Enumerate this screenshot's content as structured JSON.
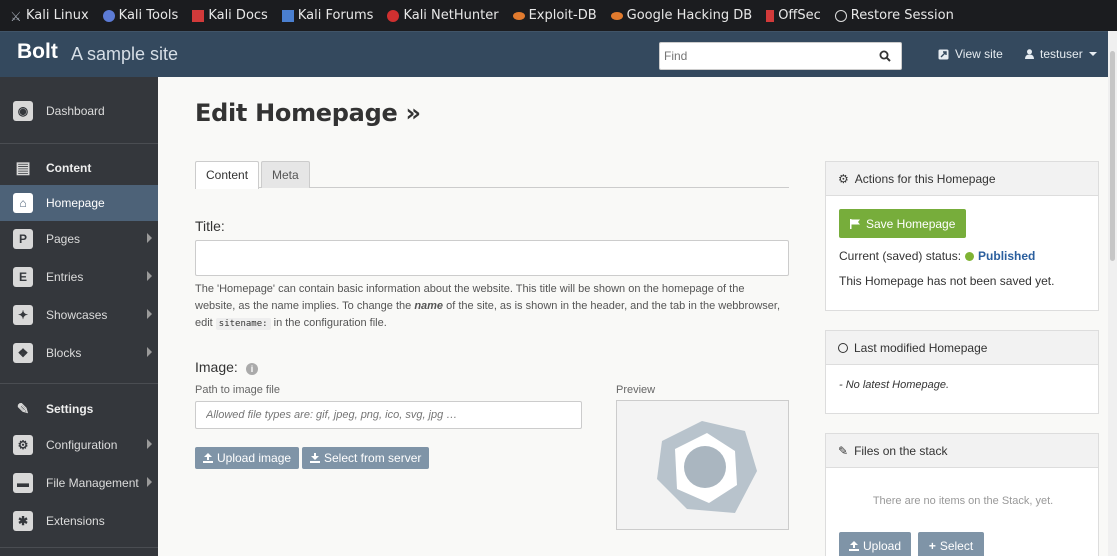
{
  "bookmarks": [
    {
      "label": "Kali Linux",
      "icon": "kali-dragon-icon",
      "color": "#a0a6b0"
    },
    {
      "label": "Kali Tools",
      "icon": "kali-tools-icon",
      "color": "#5c7bd6"
    },
    {
      "label": "Kali Docs",
      "icon": "kali-docs-icon",
      "color": "#d23a3a"
    },
    {
      "label": "Kali Forums",
      "icon": "kali-forums-icon",
      "color": "#4a7fd0"
    },
    {
      "label": "Kali NetHunter",
      "icon": "nethunter-icon",
      "color": "#cf3030"
    },
    {
      "label": "Exploit-DB",
      "icon": "exploit-db-icon",
      "color": "#e07a2e"
    },
    {
      "label": "Google Hacking DB",
      "icon": "ghdb-icon",
      "color": "#e07a2e"
    },
    {
      "label": "OffSec",
      "icon": "offsec-icon",
      "color": "#d23a3a"
    },
    {
      "label": "Restore Session",
      "icon": "globe-icon",
      "color": "#dddddd"
    }
  ],
  "topbar": {
    "brand": "Bolt",
    "site_name": "A sample site",
    "search_placeholder": "Find",
    "view_site": "View site",
    "user": "testuser"
  },
  "sidebar": {
    "items": [
      {
        "label": "Dashboard",
        "icon": "dashboard-icon",
        "glyph": "◉"
      },
      {
        "label": "Content",
        "icon": "content-file-icon",
        "glyph": "▤"
      },
      {
        "label": "Homepage",
        "icon": "home-icon",
        "glyph": "⌂"
      },
      {
        "label": "Pages",
        "icon": "pages-icon",
        "glyph": "P"
      },
      {
        "label": "Entries",
        "icon": "entries-icon",
        "glyph": "E"
      },
      {
        "label": "Showcases",
        "icon": "gift-icon",
        "glyph": "✦"
      },
      {
        "label": "Blocks",
        "icon": "blocks-icon",
        "glyph": "❖"
      },
      {
        "label": "Settings",
        "icon": "wrench-icon",
        "glyph": "🔧"
      },
      {
        "label": "Configuration",
        "icon": "cogs-icon",
        "glyph": "⚙"
      },
      {
        "label": "File Management",
        "icon": "folder-icon",
        "glyph": "▬"
      },
      {
        "label": "Extensions",
        "icon": "extensions-icon",
        "glyph": "✱"
      }
    ]
  },
  "main": {
    "title": "Edit Homepage »",
    "tabs": [
      "Content",
      "Meta"
    ],
    "title_label": "Title:",
    "help_1": "The 'Homepage' can contain basic information about the website. This title will be shown on the homepage of the website, as the name implies. To change the ",
    "help_name": "name",
    "help_2": " of the site, as is shown in the header, and the tab in the webbrowser, edit ",
    "help_code": "sitename:",
    "help_3": " in the configuration file.",
    "image_label": "Image:",
    "path_label": "Path to image file",
    "path_placeholder": "Allowed file types are: gif, jpeg, png, ico, svg, jpg …",
    "upload_image": "Upload image",
    "select_from_server": "Select from server",
    "preview_label": "Preview"
  },
  "panels": {
    "actions": {
      "title": "Actions for this Homepage",
      "save": "Save Homepage",
      "status_label": "Current (saved) status:",
      "status_value": "Published",
      "not_saved": "This Homepage has not been saved yet."
    },
    "last_modified": {
      "title": "Last modified Homepage",
      "text": "- No latest Homepage."
    },
    "stack": {
      "title": "Files on the stack",
      "empty": "There are no items on the Stack, yet.",
      "upload": "Upload",
      "select": "Select"
    }
  }
}
